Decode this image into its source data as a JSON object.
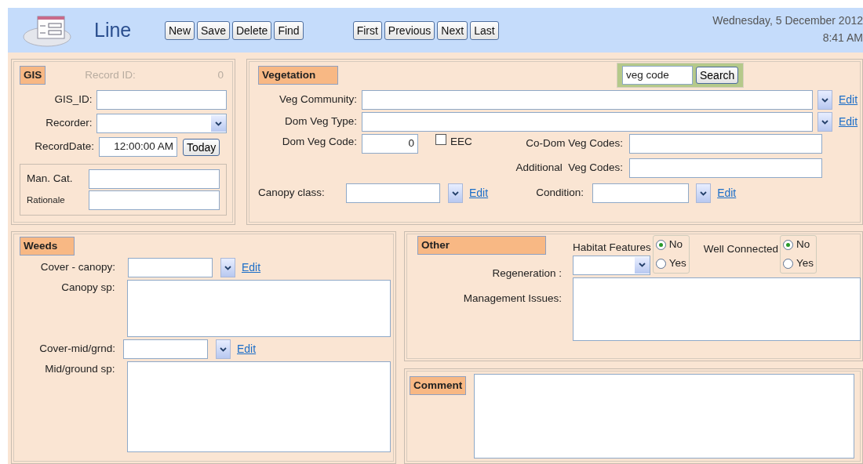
{
  "header": {
    "title": "Line",
    "record_buttons": [
      "New",
      "Save",
      "Delete",
      "Find"
    ],
    "nav_buttons": [
      "First",
      "Previous",
      "Next",
      "Last"
    ],
    "date": "Wednesday, 5 December 2012",
    "time": "8:41 AM"
  },
  "gis": {
    "heading": "GIS",
    "record_id": {
      "label": "Record ID:",
      "value": "0",
      "disabled": true
    },
    "gis_id": {
      "label": "GIS_ID:"
    },
    "recorder": {
      "label": "Recorder:"
    },
    "record_date": {
      "label": "RecordDate:",
      "value": "12:00:00 AM",
      "button": "Today"
    },
    "man_cat": {
      "label": "Man. Cat."
    },
    "rationale": {
      "label": "Rationale"
    }
  },
  "vegetation": {
    "heading": "Vegetation",
    "search": {
      "value": "veg code",
      "button": "Search"
    },
    "veg_community": {
      "label": "Veg Community:",
      "edit": "Edit"
    },
    "dom_veg_type": {
      "label": "Dom Veg Type:",
      "edit": "Edit"
    },
    "dom_veg_code": {
      "label": "Dom Veg Code:",
      "value": "0"
    },
    "eec": {
      "label": "EEC",
      "checked": false
    },
    "co_dom_veg_codes": {
      "label": "Co-Dom Veg Codes:"
    },
    "additional_veg_codes": {
      "label": "Additional  Veg Codes:"
    },
    "canopy_class": {
      "label": "Canopy class:",
      "edit": "Edit"
    },
    "condition": {
      "label": "Condition:",
      "edit": "Edit"
    }
  },
  "weeds": {
    "heading": "Weeds",
    "cover_canopy": {
      "label": "Cover - canopy:",
      "edit": "Edit"
    },
    "canopy_sp": {
      "label": "Canopy sp:"
    },
    "cover_mid": {
      "label": "Cover-mid/grnd:",
      "edit": "Edit"
    },
    "mid_sp": {
      "label": "Mid/ground sp:"
    }
  },
  "other": {
    "heading": "Other",
    "habitat_features": {
      "label": "Habitat Features",
      "options": [
        {
          "label": "No",
          "selected": true
        },
        {
          "label": "Yes",
          "selected": false
        }
      ]
    },
    "well_connected": {
      "label": "Well Connected",
      "options": [
        {
          "label": "No",
          "selected": true
        },
        {
          "label": "Yes",
          "selected": false
        }
      ]
    },
    "regeneration": {
      "label": "Regeneration :"
    },
    "management_issues": {
      "label": "Management Issues:"
    }
  },
  "comment": {
    "heading": "Comment"
  }
}
